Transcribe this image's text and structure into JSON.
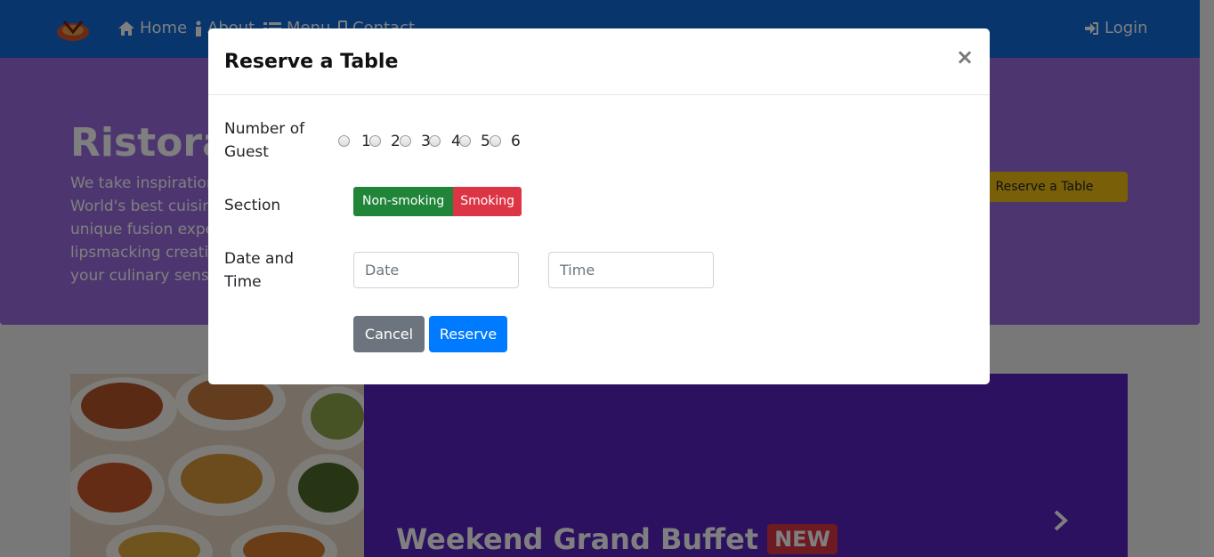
{
  "nav": {
    "home": "Home",
    "about": "About",
    "menu": "Menu",
    "contact": "Contact",
    "login": "Login"
  },
  "jumbotron": {
    "title": "Ristorante Con Fusion",
    "text": "We take inspiration from the World's best cuisines, and create a unique fusion experience. Our lipsmacking creations will tickle your culinary senses!",
    "button": "Reserve a Table"
  },
  "carousel": {
    "title": "Weekend Grand Buffet",
    "badge": "NEW"
  },
  "modal": {
    "title": "Reserve a Table",
    "close": "×",
    "guests_label": "Number of Guest",
    "guest_options": [
      "1",
      "2",
      "3",
      "4",
      "5",
      "6"
    ],
    "section_label": "Section",
    "section_options": [
      "Non-smoking",
      "Smoking"
    ],
    "datetime_label": "Date and Time",
    "date_placeholder": "Date",
    "time_placeholder": "Time",
    "cancel": "Cancel",
    "reserve": "Reserve"
  },
  "colors": {
    "navbar": "#0e6bd8",
    "jumbotron": "#9a6de0",
    "accent_yellow": "#f2c011",
    "carousel": "#5622bf",
    "success": "#208538",
    "danger": "#dc3545",
    "secondary": "#6c757d",
    "primary": "#007bff"
  }
}
